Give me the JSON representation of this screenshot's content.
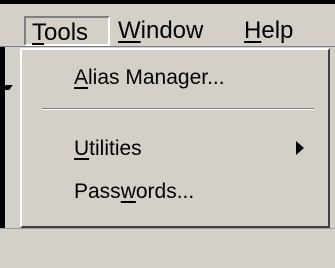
{
  "menubar": {
    "items": [
      {
        "label": "Tools",
        "underline": "T"
      },
      {
        "label": "Window",
        "underline": "W"
      },
      {
        "label": "Help",
        "underline": "H"
      }
    ]
  },
  "menu": {
    "items": [
      {
        "label": "Alias Manager...",
        "underline": "A"
      },
      {
        "label": "Utilities",
        "underline": "U",
        "submenu": true
      },
      {
        "label": "Passwords...",
        "underline": "w"
      }
    ]
  },
  "colors": {
    "chrome": "#d4d0c8",
    "shadow": "#808080",
    "highlight": "#ffffff",
    "text": "#000000"
  },
  "icons": {
    "submenu": "submenu-arrow-icon"
  }
}
